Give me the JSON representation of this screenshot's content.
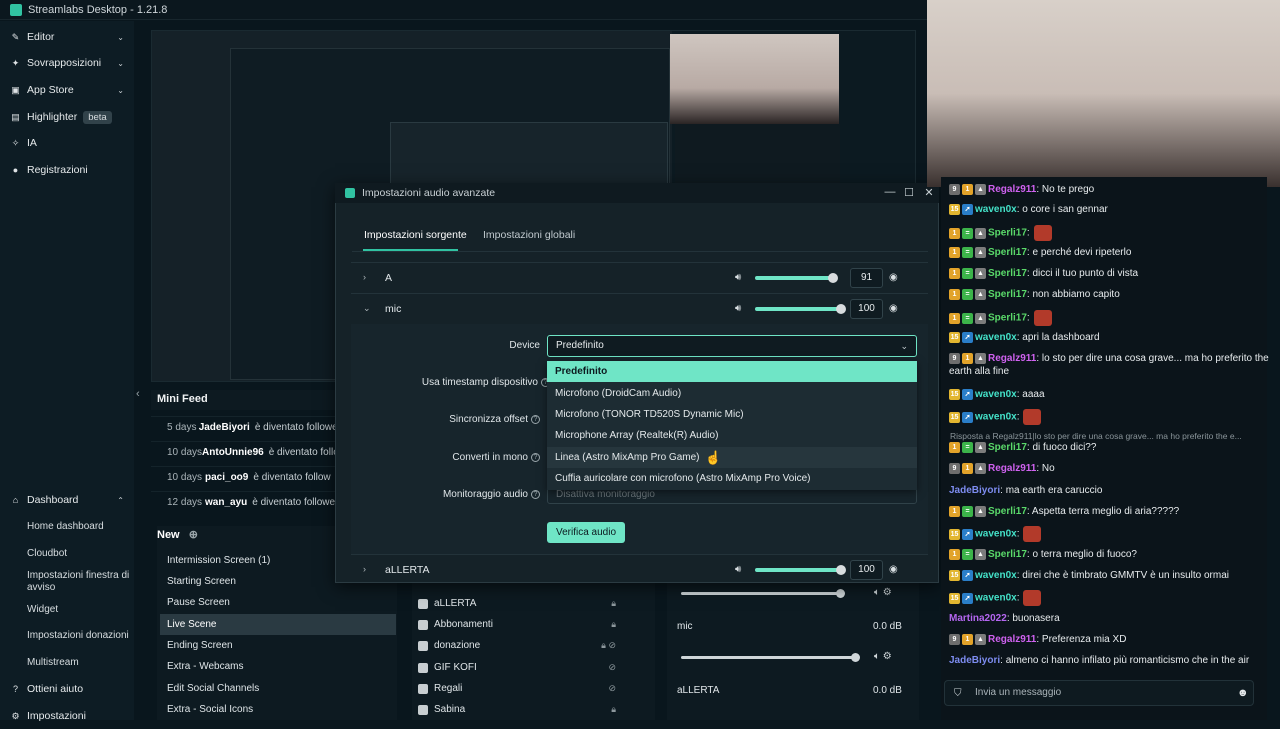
{
  "window": {
    "title": "Streamlabs Desktop - 1.21.8"
  },
  "sidebar": {
    "items": [
      {
        "label": "Editor",
        "icon": "editor-icon"
      },
      {
        "label": "Sovrapposizioni",
        "icon": "overlay-icon"
      },
      {
        "label": "App Store",
        "icon": "store-icon"
      },
      {
        "label": "Highlighter",
        "badge": "beta",
        "icon": "highlighter-icon"
      },
      {
        "label": "IA",
        "icon": "ai-icon"
      },
      {
        "label": "Registrazioni",
        "icon": "record-icon"
      }
    ],
    "dashboard": {
      "label": "Dashboard",
      "icon": "dashboard-icon"
    },
    "dashboard_items": [
      "Home dashboard",
      "Cloudbot",
      "Impostazioni finestra di avviso",
      "Widget",
      "Impostazioni donazioni",
      "Multistream"
    ],
    "help": "Ottieni aiuto",
    "settings": "Impostazioni"
  },
  "minifeed": {
    "title": "Mini Feed",
    "rows": [
      {
        "days": "5 days",
        "name": "JadeBiyori",
        "action": "è diventato follower"
      },
      {
        "days": "10 days",
        "name": "AntoUnnie96",
        "action": "è diventato follower"
      },
      {
        "days": "10 days",
        "name": "paci_oo9",
        "action": "è diventato follow"
      },
      {
        "days": "12 days",
        "name": "wan_ayu",
        "action": "è diventato follower"
      }
    ]
  },
  "scenes": {
    "collection": "New",
    "items": [
      "Intermission Screen (1)",
      "Starting Screen",
      "Pause Screen",
      "Live Scene",
      "Ending Screen",
      "Extra - Webcams",
      "Edit Social Channels",
      "Extra - Social Icons"
    ],
    "active": "Live Scene"
  },
  "sources": [
    "aLLERTA",
    "Abbonamenti",
    "donazione",
    "GIF KOFI",
    "Regali",
    "Sabina"
  ],
  "mixer": [
    {
      "label": "mic",
      "db": "0.0 dB"
    },
    {
      "label": "aLLERTA",
      "db": "0.0 dB"
    }
  ],
  "modal": {
    "title": "Impostazioni audio avanzate",
    "tabs": [
      "Impostazioni sorgente",
      "Impostazioni globali"
    ],
    "sources": [
      {
        "name": "A",
        "volume": "91",
        "fill": 0.91
      },
      {
        "name": "mic",
        "volume": "100",
        "fill": 1.0
      },
      {
        "name": "aLLERTA",
        "volume": "100",
        "fill": 1.0
      }
    ],
    "fields": {
      "device": "Device",
      "timestamp": "Usa timestamp dispositivo",
      "sync": "Sincronizza offset",
      "mono": "Converti in mono",
      "monitor": "Monitoraggio audio"
    },
    "device_value": "Predefinito",
    "monitor_value": "Disattiva monitoraggio",
    "device_options": [
      "Predefinito",
      "Microfono (DroidCam Audio)",
      "Microfono (TONOR TD520S Dynamic Mic)",
      "Microphone Array (Realtek(R) Audio)",
      "Linea (Astro MixAmp Pro Game)",
      "Cuffia auricolare con microfono (Astro MixAmp Pro Voice)"
    ],
    "verify_button": "Verifica audio"
  },
  "chat": {
    "reply_note": "Risposta a Regalz911|lo sto per dire una cosa grave... ma ho preferito the e...",
    "messages": [
      {
        "user": "Regalz911",
        "color": "pink",
        "text": ": No te prego"
      },
      {
        "user": "waven0x",
        "color": "teal",
        "text": ": o core i san gennar"
      },
      {
        "user": "Sperli17",
        "color": "green",
        "text": ":",
        "emote": true
      },
      {
        "user": "Sperli17",
        "color": "green",
        "text": ": e perché devi ripeterlo"
      },
      {
        "user": "Sperli17",
        "color": "green",
        "text": ": dicci il tuo punto di vista"
      },
      {
        "user": "Sperli17",
        "color": "green",
        "text": ": non abbiamo capito"
      },
      {
        "user": "Sperli17",
        "color": "green",
        "text": ":",
        "emote": true
      },
      {
        "user": "waven0x",
        "color": "teal",
        "text": ": apri la dashboard"
      },
      {
        "user": "Regalz911",
        "color": "pink",
        "text": ": lo sto per dire una cosa grave... ma ho preferito the earth alla fine"
      },
      {
        "user": "waven0x",
        "color": "teal",
        "text": ": aaaa"
      },
      {
        "user": "waven0x",
        "color": "teal",
        "text": ":",
        "emote": true
      },
      {
        "user": "Sperli17",
        "color": "green",
        "text": ": di fuoco dici??"
      },
      {
        "user": "Regalz911",
        "color": "pink",
        "text": ": No"
      },
      {
        "user": "JadeBiyori",
        "color": "blue",
        "text": ": ma earth era caruccio"
      },
      {
        "user": "Sperli17",
        "color": "green",
        "text": ": Aspetta terra meglio di aria?????"
      },
      {
        "user": "waven0x",
        "color": "teal",
        "text": ":",
        "emote": true
      },
      {
        "user": "Sperli17",
        "color": "green",
        "text": ": o terra meglio di fuoco?"
      },
      {
        "user": "waven0x",
        "color": "teal",
        "text": ": direi che è timbrato GMMTV è un insulto ormai"
      },
      {
        "user": "waven0x",
        "color": "teal",
        "text": ":",
        "emote": true
      },
      {
        "user": "Martina2022",
        "color": "purple",
        "text": ": buonasera"
      },
      {
        "user": "Regalz911",
        "color": "pink",
        "text": ": Preferenza mia XD"
      },
      {
        "user": "JadeBiyori",
        "color": "blue",
        "text": ": almeno ci hanno infilato più romanticismo che in the air"
      }
    ],
    "input_placeholder": "Invia un messaggio"
  },
  "colors": {
    "accent": "#6fe5c6",
    "brand": "#31c3a2"
  }
}
